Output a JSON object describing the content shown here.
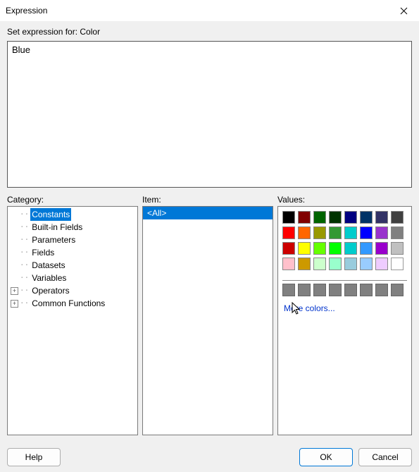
{
  "window": {
    "title": "Expression",
    "close_tooltip": "Close"
  },
  "set_label": "Set expression for: Color",
  "expression": "Blue",
  "labels": {
    "category": "Category:",
    "item": "Item:",
    "values": "Values:"
  },
  "category_tree": {
    "items": [
      {
        "label": "Constants",
        "expandable": false,
        "selected": true
      },
      {
        "label": "Built-in Fields",
        "expandable": false,
        "selected": false
      },
      {
        "label": "Parameters",
        "expandable": false,
        "selected": false
      },
      {
        "label": "Fields",
        "expandable": false,
        "selected": false
      },
      {
        "label": "Datasets",
        "expandable": false,
        "selected": false
      },
      {
        "label": "Variables",
        "expandable": false,
        "selected": false
      },
      {
        "label": "Operators",
        "expandable": true,
        "selected": false
      },
      {
        "label": "Common Functions",
        "expandable": true,
        "selected": false
      }
    ]
  },
  "items": [
    {
      "label": "<All>",
      "selected": true
    }
  ],
  "color_rows": [
    [
      "#000000",
      "#800000",
      "#006400",
      "#003300",
      "#000080",
      "#003366",
      "#333366",
      "#404040"
    ],
    [
      "#ff0000",
      "#ff6600",
      "#999900",
      "#339933",
      "#00cccc",
      "#0000ff",
      "#9933cc",
      "#808080"
    ],
    [
      "#cc0000",
      "#ffff00",
      "#66ff00",
      "#00ff00",
      "#00cccc",
      "#3399ff",
      "#9900cc",
      "#c0c0c0"
    ],
    [
      "#ffc0cb",
      "#cc9900",
      "#ccffcc",
      "#99ffcc",
      "#99ccdd",
      "#99ccff",
      "#eeccff",
      "#ffffff"
    ]
  ],
  "extra_swatches": 8,
  "more_colors": "More colors...",
  "buttons": {
    "help": "Help",
    "ok": "OK",
    "cancel": "Cancel"
  }
}
